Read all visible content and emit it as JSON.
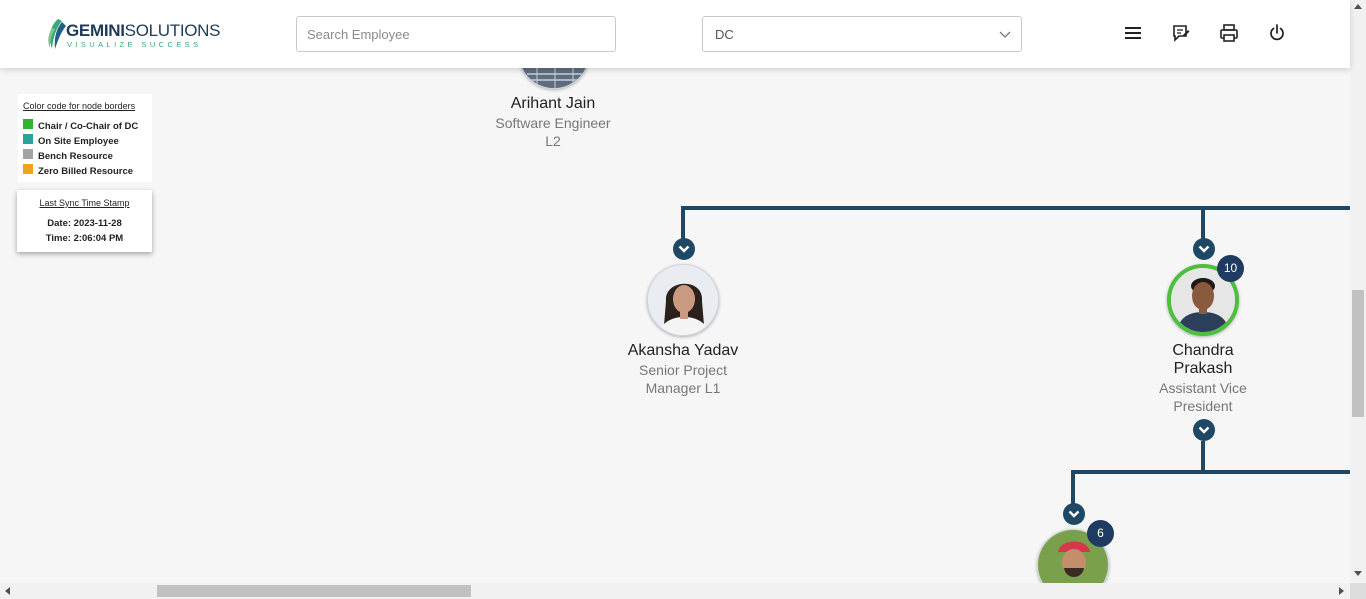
{
  "header": {
    "logo": {
      "name_bold": "GEMINI",
      "name_light": "SOLUTIONS",
      "tagline": "VISUALIZE SUCCESS"
    },
    "search": {
      "placeholder": "Search Employee",
      "value": ""
    },
    "department_select": {
      "selected": "DC"
    },
    "icons": [
      "menu-icon",
      "feedback-icon",
      "print-icon",
      "power-icon"
    ]
  },
  "legend": {
    "title": "Color code for node borders",
    "items": [
      {
        "label": "Chair / Co-Chair of DC",
        "color": "#2fb52f"
      },
      {
        "label": "On Site Employee",
        "color": "#2aa29b"
      },
      {
        "label": "Bench Resource",
        "color": "#a3a3a3"
      },
      {
        "label": "Zero Billed Resource",
        "color": "#f3a21b"
      }
    ]
  },
  "sync": {
    "title": "Last Sync Time Stamp",
    "date": "Date: 2023-11-28",
    "time": "Time: 2:06:04 PM"
  },
  "nodes": {
    "arihant": {
      "name": "Arihant Jain",
      "title_line1": "Software Engineer",
      "title_line2": "L2"
    },
    "akansha": {
      "name": "Akansha Yadav",
      "title_line1": "Senior Project",
      "title_line2": "Manager L1"
    },
    "chandra": {
      "name_line1": "Chandra",
      "name_line2": "Prakash",
      "title_line1": "Assistant Vice",
      "title_line2": "President",
      "reports_count": "10",
      "border_color": "#4cbf3c"
    },
    "child": {
      "reports_count": "6"
    }
  },
  "colors": {
    "connector": "#1f4766",
    "badge": "#1f3b62",
    "chair_border": "#4cbf3c"
  }
}
